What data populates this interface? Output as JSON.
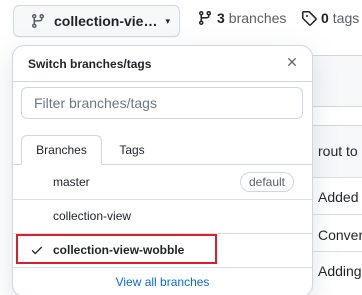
{
  "branch_selector": {
    "current_label": "collection-vie…",
    "icon": "git-branch-icon",
    "caret": "▾"
  },
  "stats": {
    "branches_count": "3",
    "branches_label": "branches",
    "tags_count": "0",
    "tags_label": "tags"
  },
  "popover": {
    "title": "Switch branches/tags",
    "filter_placeholder": "Filter branches/tags",
    "tabs": [
      {
        "label": "Branches",
        "active": true
      },
      {
        "label": "Tags",
        "active": false
      }
    ],
    "branches": [
      {
        "name": "master",
        "badge": "default",
        "selected": false
      },
      {
        "name": "collection-view",
        "badge": null,
        "selected": false
      },
      {
        "name": "collection-view-wobble",
        "badge": null,
        "selected": true
      }
    ],
    "view_all": "View all branches"
  },
  "background": {
    "text_1": "rout to C",
    "text_2": "Added",
    "text_3": "Conver",
    "text_4": "Adding"
  },
  "colors": {
    "accent_link": "#0969da",
    "highlight_red": "#d6212c",
    "border": "#d0d7de"
  }
}
